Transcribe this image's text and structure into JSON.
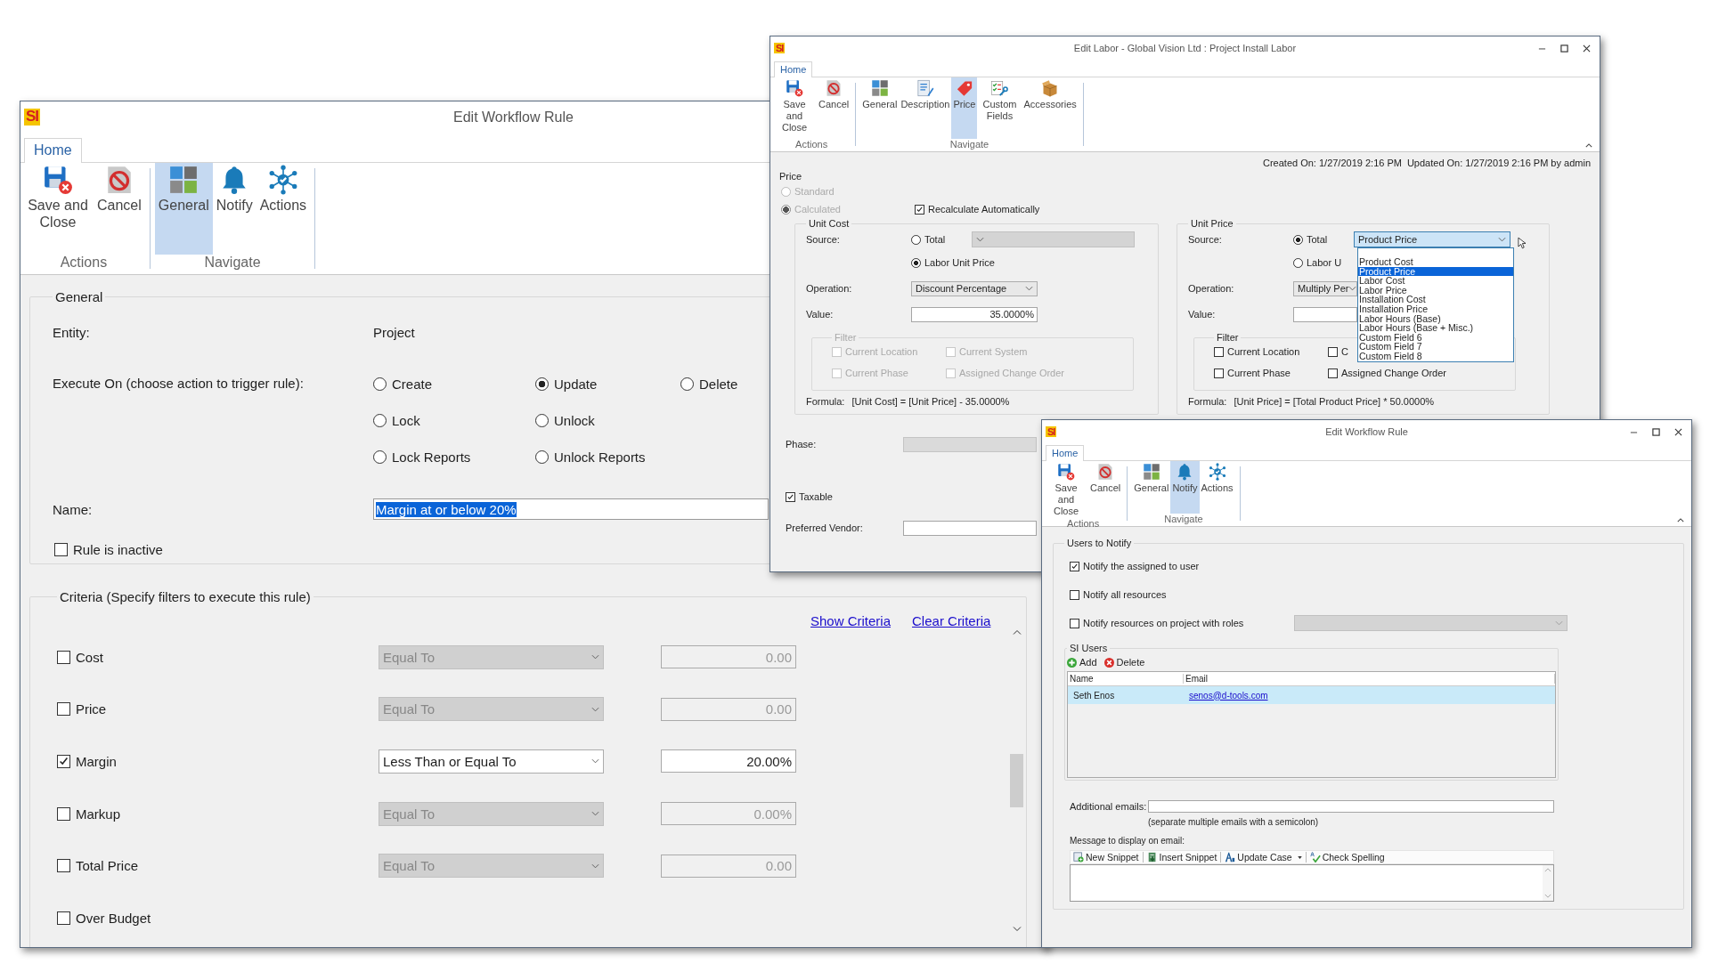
{
  "windows": [
    {
      "kind": "workflow_general",
      "logo": "SI",
      "title": "Edit Workflow Rule",
      "tabs": [
        {
          "label": "Home",
          "selected": true
        }
      ],
      "ribbon": [
        {
          "label": "Actions",
          "buttons": [
            {
              "label": "Save and Close",
              "kind": "save",
              "selected": false
            },
            {
              "label": "Cancel",
              "kind": "cancel",
              "selected": false
            }
          ]
        },
        {
          "label": "Navigate",
          "buttons": [
            {
              "label": "General",
              "kind": "general",
              "selected": true
            },
            {
              "label": "Notify",
              "kind": "notify",
              "selected": false
            },
            {
              "label": "Actions",
              "kind": "actions",
              "selected": false
            }
          ]
        }
      ],
      "general": {
        "legend": "General",
        "entity_label": "Entity:",
        "entity_value": "Project",
        "execute_label": "Execute On (choose action to trigger rule):",
        "execute_options": [
          [
            {
              "label": "Create",
              "selected": false
            },
            {
              "label": "Update",
              "selected": true
            },
            {
              "label": "Delete",
              "selected": false
            }
          ],
          [
            {
              "label": "Lock",
              "selected": false
            },
            {
              "label": "Unlock",
              "selected": false
            }
          ],
          [
            {
              "label": "Lock Reports",
              "selected": false
            },
            {
              "label": "Unlock Reports",
              "selected": false
            }
          ]
        ],
        "name_label": "Name:",
        "name_value": "Margin at or below 20%",
        "name_selected": true,
        "inactive": {
          "label": "Rule is inactive",
          "checked": false
        }
      },
      "criteria": {
        "legend": "Criteria (Specify filters to execute this rule)",
        "links": [
          "Show Criteria",
          "Clear Criteria"
        ],
        "rows": [
          {
            "label": "Cost",
            "checked": false,
            "operator": "Equal To",
            "value": "0.00"
          },
          {
            "label": "Price",
            "checked": false,
            "operator": "Equal To",
            "value": "0.00"
          },
          {
            "label": "Margin",
            "checked": true,
            "operator": "Less Than or Equal To",
            "value": "20.00%"
          },
          {
            "label": "Markup",
            "checked": false,
            "operator": "Equal To",
            "value": "0.00%"
          },
          {
            "label": "Total Price",
            "checked": false,
            "operator": "Equal To",
            "value": "0.00"
          },
          {
            "label": "Over Budget",
            "checked": false
          }
        ]
      }
    },
    {
      "kind": "labor_price",
      "logo": "SI",
      "title": "Edit Labor - Global Vision Ltd : Project Install Labor",
      "tabs": [
        {
          "label": "Home",
          "selected": true
        }
      ],
      "ribbon": [
        {
          "label": "Actions",
          "buttons": [
            {
              "label": "Save and Close",
              "kind": "save",
              "selected": false
            },
            {
              "label": "Cancel",
              "kind": "cancel",
              "selected": false
            }
          ]
        },
        {
          "label": "Navigate",
          "buttons": [
            {
              "label": "General",
              "kind": "general",
              "selected": false
            },
            {
              "label": "Description",
              "kind": "description",
              "selected": false
            },
            {
              "label": "Price",
              "kind": "price",
              "selected": true
            },
            {
              "label": "Custom Fields",
              "kind": "custom_fields",
              "selected": false
            },
            {
              "label": "Accessories",
              "kind": "accessories",
              "selected": false
            }
          ]
        }
      ],
      "created": "Created On: 1/27/2019 2:16 PM",
      "updated": "Updated On: 1/27/2019 2:16 PM by admin",
      "price": {
        "legend": "Price",
        "modes": [
          {
            "label": "Standard",
            "selected": false,
            "disabled": true
          },
          {
            "label": "Calculated",
            "selected": true,
            "disabled": true
          }
        ],
        "recalculate": {
          "label": "Recalculate Automatically",
          "checked": true
        }
      },
      "unit_cost": {
        "legend": "Unit Cost",
        "source_label": "Source:",
        "sources": [
          {
            "label": "Total",
            "selected": false
          },
          {
            "label": "Labor Unit Price",
            "selected": true
          }
        ],
        "source_combo": {
          "disabled": true
        },
        "operation_label": "Operation:",
        "operation": "Discount Percentage",
        "value_label": "Value:",
        "value": "35.0000%",
        "filter": {
          "legend": "Filter",
          "disabled": true,
          "items": [
            {
              "label": "Current Location",
              "checked": false
            },
            {
              "label": "Current System",
              "checked": false
            },
            {
              "label": "Current Phase",
              "checked": false
            },
            {
              "label": "Assigned Change Order",
              "checked": false
            }
          ]
        },
        "formula_label": "Formula:",
        "formula": "[Unit Cost] = [Unit Price] - 35.0000%"
      },
      "unit_price": {
        "legend": "Unit Price",
        "source_label": "Source:",
        "sources": [
          {
            "label": "Total",
            "selected": true
          },
          {
            "label": "Labor U",
            "selected": false
          }
        ],
        "source_combo": {
          "disabled": false,
          "value": "Product Price",
          "open": true,
          "options": [
            {
              "label": "Product Cost",
              "selected": false
            },
            {
              "label": "Product Price",
              "selected": true
            },
            {
              "label": "Labor Cost",
              "selected": false
            },
            {
              "label": "Labor Price",
              "selected": false
            },
            {
              "label": "Installation Cost",
              "selected": false
            },
            {
              "label": "Installation Price",
              "selected": false
            },
            {
              "label": "Labor Hours (Base)",
              "selected": false
            },
            {
              "label": "Labor Hours (Base + Misc.)",
              "selected": false
            },
            {
              "label": "Custom Field 6",
              "selected": false
            },
            {
              "label": "Custom Field 7",
              "selected": false
            },
            {
              "label": "Custom Field 8",
              "selected": false
            }
          ]
        },
        "operation_label": "Operation:",
        "operation": "Multiply Per",
        "value_label": "Value:",
        "filter": {
          "legend": "Filter",
          "disabled": false,
          "items": [
            {
              "label": "Current Location",
              "checked": false
            },
            {
              "label": "C",
              "checked": false
            },
            {
              "label": "Current Phase",
              "checked": false
            },
            {
              "label": "Assigned Change Order",
              "checked": false
            }
          ]
        },
        "formula_label": "Formula:",
        "formula": "[Unit Price] = [Total Product Price] * 50.0000%"
      },
      "phase_label": "Phase:",
      "phase_disabled": true,
      "taxable": {
        "label": "Taxable",
        "checked": true
      },
      "vendor_label": "Preferred Vendor:"
    },
    {
      "kind": "notify",
      "logo": "SI",
      "title": "Edit Workflow Rule",
      "tabs": [
        {
          "label": "Home",
          "selected": true
        }
      ],
      "ribbon": [
        {
          "label": "Actions",
          "buttons": [
            {
              "label": "Save and Close",
              "kind": "save",
              "selected": false
            },
            {
              "label": "Cancel",
              "kind": "cancel",
              "selected": false
            }
          ]
        },
        {
          "label": "Navigate",
          "buttons": [
            {
              "label": "General",
              "kind": "general",
              "selected": false
            },
            {
              "label": "Notify",
              "kind": "notify",
              "selected": true
            },
            {
              "label": "Actions",
              "kind": "actions",
              "selected": false
            }
          ]
        }
      ],
      "users": {
        "legend": "Users to Notify",
        "options": [
          {
            "label": "Notify the assigned to user",
            "checked": true,
            "has_combo": false
          },
          {
            "label": "Notify all resources",
            "checked": false,
            "has_combo": false
          },
          {
            "label": "Notify resources on project with roles",
            "checked": false,
            "has_combo": true
          }
        ],
        "si_users": {
          "legend": "SI Users",
          "buttons": [
            {
              "label": "Add",
              "kind": "add"
            },
            {
              "label": "Delete",
              "kind": "delete"
            }
          ],
          "columns": [
            "Name",
            "Email"
          ],
          "rows": [
            {
              "name": "Seth Enos",
              "email": "senos@d-tools.com",
              "selected": true
            }
          ]
        },
        "additional_label": "Additional emails:",
        "additional_hint": "(separate multiple emails with a semicolon)",
        "message_label": "Message to display on email:",
        "toolbar": [
          {
            "label": "New Snippet",
            "kind": "new_snippet",
            "menu": false
          },
          {
            "label": "Insert Snippet",
            "kind": "insert_snippet",
            "menu": false
          },
          {
            "label": "Update Case",
            "kind": "update_case",
            "menu": true
          },
          {
            "label": "Check Spelling",
            "kind": "spelling",
            "menu": false
          }
        ]
      }
    }
  ]
}
